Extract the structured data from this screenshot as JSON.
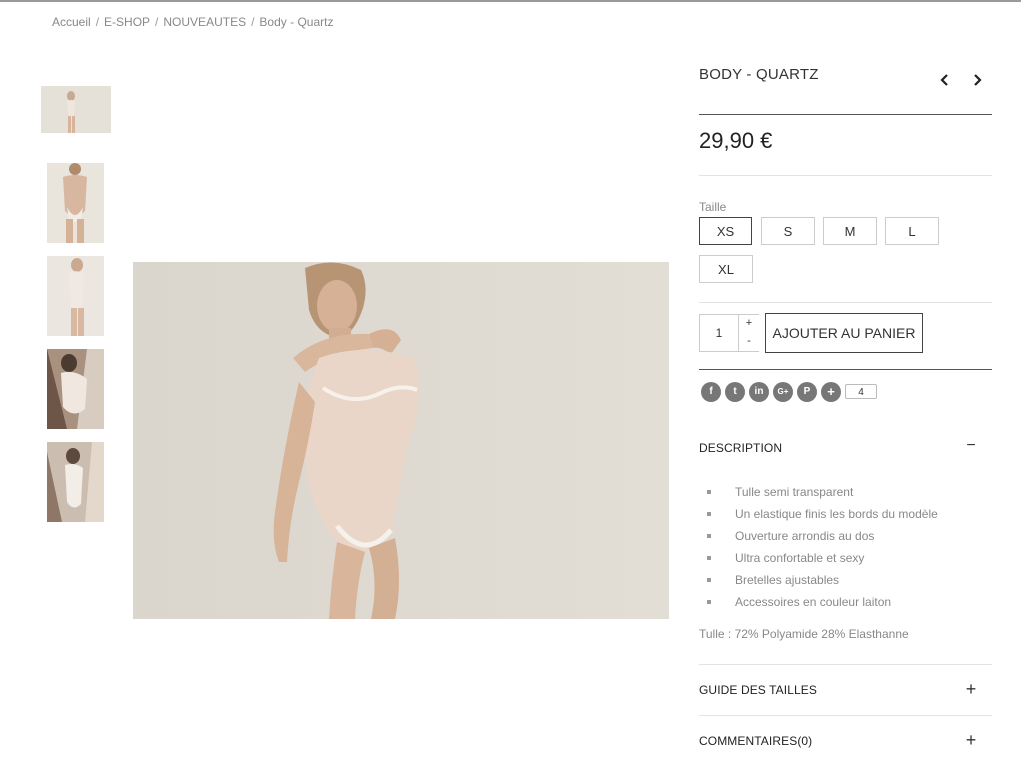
{
  "breadcrumb": [
    "Accueil",
    "E-SHOP",
    "NOUVEAUTES",
    "Body - Quartz"
  ],
  "breadcrumb_separator": "/",
  "product": {
    "title": "BODY - QUARTZ",
    "price": "29,90 €",
    "size_label": "Taille",
    "sizes": [
      "XS",
      "S",
      "M",
      "L",
      "XL"
    ],
    "selected_size": "XS",
    "quantity": "1",
    "qty_plus": "+",
    "qty_minus": "-",
    "add_to_cart": "AJOUTER AU PANIER"
  },
  "social": {
    "icons": [
      "facebook-icon",
      "twitter-icon",
      "linkedin-icon",
      "google-plus-icon",
      "pinterest-icon",
      "more-share-icon"
    ],
    "glyphs": [
      "f",
      "t",
      "in",
      "G+",
      "P",
      "+"
    ],
    "share_count": "4"
  },
  "accordion": {
    "description": {
      "title": "DESCRIPTION",
      "toggle": "−",
      "items": [
        "Tulle semi transparent",
        "Un elastique finis les bords du modèle",
        "Ouverture arrondis au dos",
        "Ultra confortable et sexy",
        "Bretelles ajustables",
        "Accessoires en couleur laiton"
      ],
      "composition": "Tulle : 72% Polyamide 28% Elasthanne"
    },
    "size_guide": {
      "title": "GUIDE DES TAILLES",
      "toggle": "+"
    },
    "comments": {
      "title": "COMMENTAIRES(0)",
      "toggle": "+"
    }
  },
  "colors": {
    "accent": "#333333",
    "muted_text": "#888888",
    "social_bg": "#777777"
  }
}
